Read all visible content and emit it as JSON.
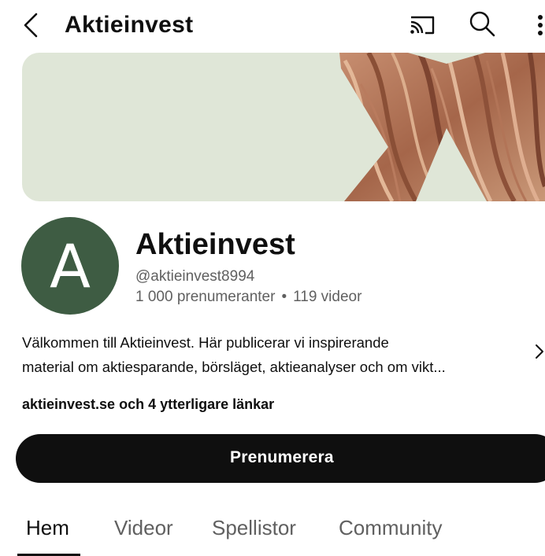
{
  "header": {
    "title": "Aktieinvest",
    "icons": {
      "back": "chevron-left-icon",
      "cast": "cast-icon",
      "search": "search-icon",
      "more": "more-vert-icon"
    }
  },
  "banner": {
    "background": "#dfe6d7"
  },
  "channel": {
    "avatar_letter": "A",
    "avatar_color": "#3e5c43",
    "name": "Aktieinvest",
    "handle": "@aktieinvest8994",
    "subscribers": "1 000 prenumeranter",
    "separator": "•",
    "videos": "119 videor",
    "description_line1": "Välkommen till Aktieinvest. Här publicerar vi inspirerande",
    "description_line2": "material om aktiesparande, börsläget, aktieanalyser och om vikt...",
    "links": "aktieinvest.se och 4 ytterligare länkar"
  },
  "actions": {
    "subscribe_label": "Prenumerera"
  },
  "tabs": [
    {
      "label": "Hem",
      "active": true
    },
    {
      "label": "Videor",
      "active": false
    },
    {
      "label": "Spellistor",
      "active": false
    },
    {
      "label": "Community",
      "active": false
    }
  ]
}
